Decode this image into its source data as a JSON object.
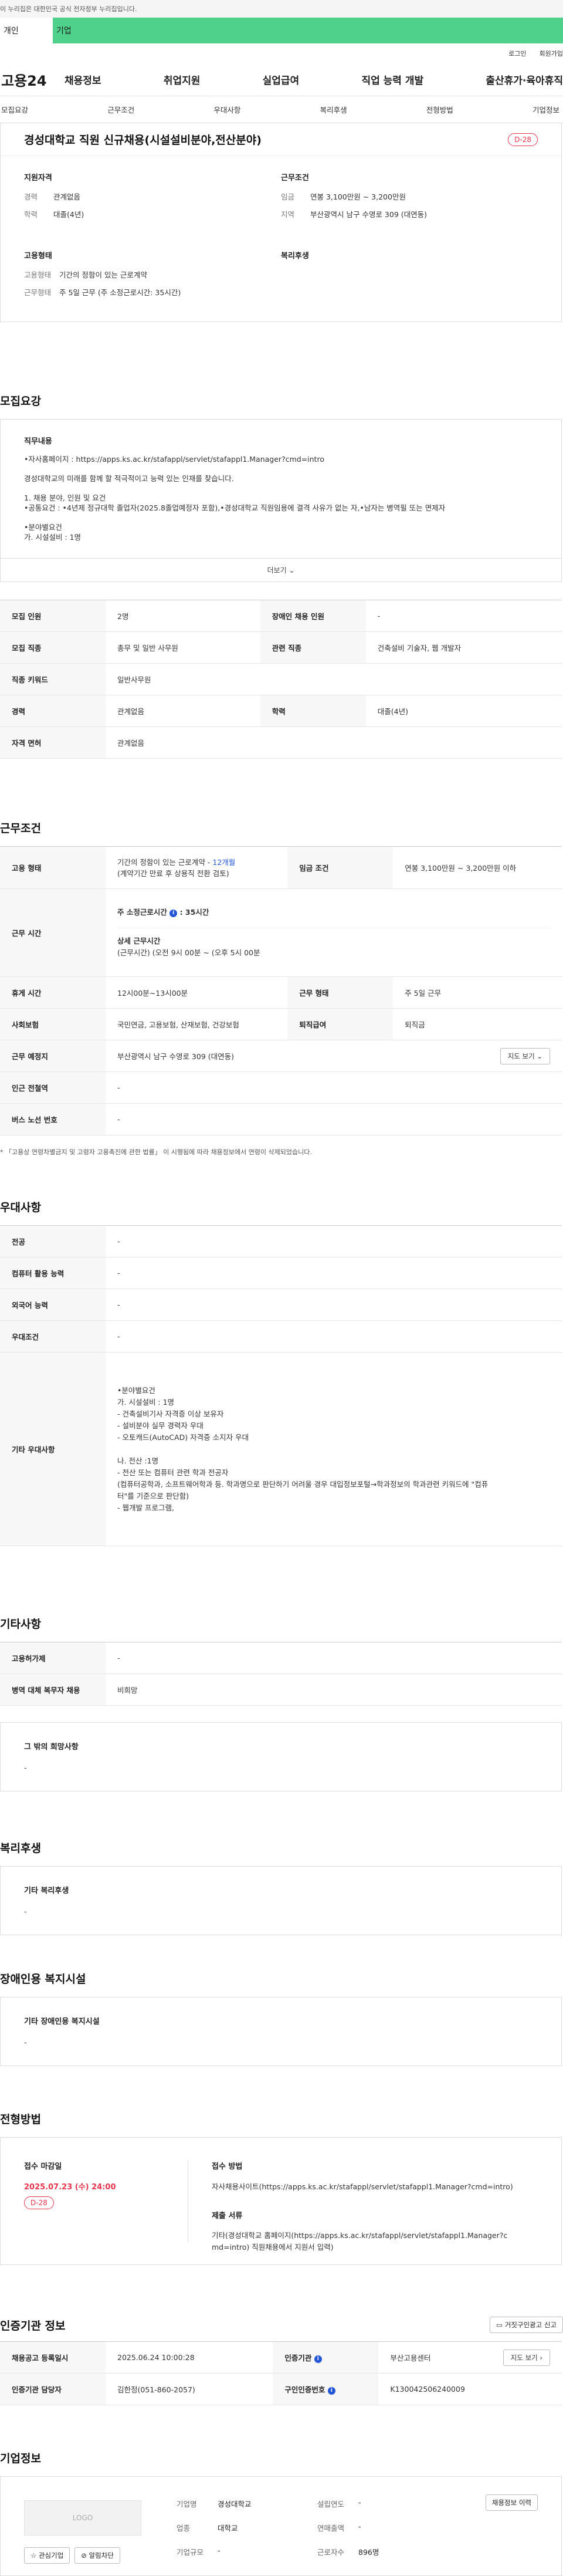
{
  "gov_banner": "이 누리집은 대한민국 공식 전자정부 누리집입니다.",
  "top_tabs": [
    "개인",
    "기업"
  ],
  "util_links": [
    "로그인",
    "회원가입"
  ],
  "site": {
    "logo": "고용24",
    "menu": [
      "채용정보",
      "취업지원",
      "실업급여",
      "직업 능력 개발",
      "출산휴가·육아휴직"
    ]
  },
  "anchor_nav": [
    "모집요강",
    "근무조건",
    "우대사항",
    "복리후생",
    "전형방법",
    "기업정보"
  ],
  "summary": {
    "title": "경성대학교 직원 신규채용(시설설비분야,전산분야)",
    "dday": "D-28",
    "qualification": {
      "title": "지원자격",
      "rows": [
        {
          "k": "경력",
          "v": "관계없음"
        },
        {
          "k": "학력",
          "v": "대졸(4년)"
        }
      ]
    },
    "conditions": {
      "title": "근무조건",
      "rows": [
        {
          "k": "임금",
          "v": "연봉 3,100만원 ~ 3,200만원"
        },
        {
          "k": "지역",
          "v": "부산광역시 남구 수영로 309 (대연동)"
        }
      ]
    },
    "employment": {
      "title": "고용형태",
      "rows": [
        {
          "k": "고용형태",
          "v": "기간의 정함이 있는 근로계약"
        },
        {
          "k": "근무형태",
          "v": "주 5일 근무 (주 소정근로시간: 35시간)"
        }
      ]
    },
    "welfare": {
      "title": "복리후생"
    }
  },
  "recruit": {
    "section_title": "모집요강",
    "desc_title": "직무내용",
    "lines": [
      "•자사홈페이지 : https://apps.ks.ac.kr/stafappl/servlet/stafappl1.Manager?cmd=intro",
      "",
      "경성대학교의 미래를 함께 할 적극적이고 능력 있는 인재를 찾습니다.",
      "",
      "1. 채용 분야, 인원 및 요건",
      "•공통요건 : •4년제 정규대학 졸업자(2025.8졸업예정자 포함),•경성대학교 직원임용에 결격 사유가 없는 자,•남자는 병역필 또는 면제자",
      "",
      "•분야별요건",
      "가. 시설설비 : 1명"
    ],
    "more": "더보기",
    "table": [
      [
        {
          "h": "모집 인원"
        },
        {
          "v": "2명"
        },
        {
          "h": "장애인 채용 인원"
        },
        {
          "v": "-"
        }
      ],
      [
        {
          "h": "모집 직종"
        },
        {
          "v": "총무 및 일반 사무원"
        },
        {
          "h": "관련 직종"
        },
        {
          "v": "건축설비 기술자, 웹 개발자"
        }
      ],
      [
        {
          "h": "직종 키워드"
        },
        {
          "v": "일반사무원",
          "span": 3
        }
      ],
      [
        {
          "h": "경력"
        },
        {
          "v": "관계없음"
        },
        {
          "h": "학력"
        },
        {
          "v": "대졸(4년)"
        }
      ],
      [
        {
          "h": "자격 면허"
        },
        {
          "v": "관계없음",
          "span": 3
        }
      ]
    ]
  },
  "work": {
    "section_title": "근무조건",
    "employment_type_h": "고용 형태",
    "employment_type_v1": "기간의 정함이 있는 근로계약 -",
    "employment_type_months": "12개월",
    "employment_type_v2": "(계약기간 만료 후 상용직 전환 검토)",
    "wage_h": "임금 조건",
    "wage_v": "연봉 3,100만원 ~ 3,200만원 이하",
    "hours_h": "근무 시간",
    "weekly_hours_label": "주 소정근로시간",
    "weekly_hours_value": ": 35시간",
    "detail_hours_label": "상세 근무시간",
    "detail_hours_value": "(근무시간) (오전 9시 00분 ~ (오후 5시 00분",
    "rest_h": "휴게 시간",
    "rest_v": "12시00분~13시00분",
    "shift_h": "근무 형태",
    "shift_v": "주 5일 근무",
    "insurance_h": "사회보험",
    "insurance_v": "국민연금, 고용보험, 산재보험, 건강보험",
    "retire_h": "퇴직급여",
    "retire_v": "퇴직금",
    "place_h": "근무 예정지",
    "place_v": "부산광역시 남구 수영로 309 (대연동)",
    "map_btn": "지도 보기",
    "subway_h": "인근 전철역",
    "subway_v": "-",
    "bus_h": "버스 노선 번호",
    "bus_v": "-",
    "note": "* 「고용상 연령차별금지 및 고령자 고용촉진에 관한 법률」 이 시행됨에 따라 채용정보에서 연령이 삭제되었습니다."
  },
  "preference": {
    "section_title": "우대사항",
    "rows": [
      {
        "h": "전공",
        "v": "-"
      },
      {
        "h": "컴퓨터 활용 능력",
        "v": "-"
      },
      {
        "h": "외국어 능력",
        "v": "-"
      },
      {
        "h": "우대조건",
        "v": "-"
      }
    ],
    "other_h": "기타 우대사항",
    "other_lines": [
      "•분야별요건",
      "가. 시설설비 : 1명",
      "- 건축설비기사 자격증 이상 보유자",
      "- 설비분야 실무 경력자 우대",
      "- 오토캐드(AutoCAD) 자격증 소지자 우대",
      "",
      "나. 전산 :1명",
      "- 전산 또는 컴퓨터 관련 학과 전공자",
      "(컴퓨터공학과, 소프트웨어학과 등. 학과명으로 판단하기 어려울 경우 대입정보포털→학과정보의 학과관련 키워드에 \"컴퓨",
      "터\"를 기준으로 판단함)",
      "- 웹개발 프로그램,"
    ]
  },
  "other": {
    "section_title": "기타사항",
    "rows": [
      {
        "h": "고용허가제",
        "v": "-"
      },
      {
        "h": "병역 대체 복무자 채용",
        "v": "비희망"
      }
    ],
    "extra_title": "그 밖의 희망사항",
    "extra_value": "-"
  },
  "welfare": {
    "section_title": "복리후생",
    "card_title": "기타 복리후생",
    "card_value": "-"
  },
  "disabled": {
    "section_title": "장애인용 복지시설",
    "card_title": "기타 장애인용 복지시설",
    "card_value": "-"
  },
  "selection": {
    "section_title": "전형방법",
    "deadline_label": "접수 마감일",
    "deadline_value": "2025.07.23 (수) 24:00",
    "dday": "D-28",
    "method_label": "접수 방법",
    "method_value": "자사채용사이트(https://apps.ks.ac.kr/stafappl/servlet/stafappl1.Manager?cmd=intro)",
    "docs_label": "제출 서류",
    "docs_line1": "기타(경성대학교 홈페이지(https://apps.ks.ac.kr/stafappl/servlet/stafappl1.Manager?c",
    "docs_line2": "md=intro) 직원채용에서 지원서 입력)"
  },
  "agency": {
    "section_title": "인증기관 정보",
    "report_btn": "거짓구인광고 신고",
    "reg_date_h": "채용공고 등록일시",
    "reg_date_v": "2025.06.24 10:00:28",
    "agency_h": "인증기관",
    "agency_v": "부산고용센터",
    "map_btn": "지도 보기",
    "manager_h": "인증기관 담당자",
    "manager_v": "김한정(051-860-2057)",
    "auth_no_h": "구인인증번호",
    "auth_no_v": "K130042506240009"
  },
  "company": {
    "section_title": "기업정보",
    "logo": "LOGO",
    "interest_btn": "관심기업",
    "follow_btn": "알림차단",
    "history_btn": "채용정보 이력",
    "fields": [
      {
        "k": "기업명",
        "v": "경성대학교"
      },
      {
        "k": "설립연도",
        "v": "-"
      },
      {
        "k": "업종",
        "v": "대학교"
      },
      {
        "k": "연매출액",
        "v": "-"
      },
      {
        "k": "기업규모",
        "v": "-"
      },
      {
        "k": "근로자수",
        "v": "896명"
      }
    ]
  }
}
